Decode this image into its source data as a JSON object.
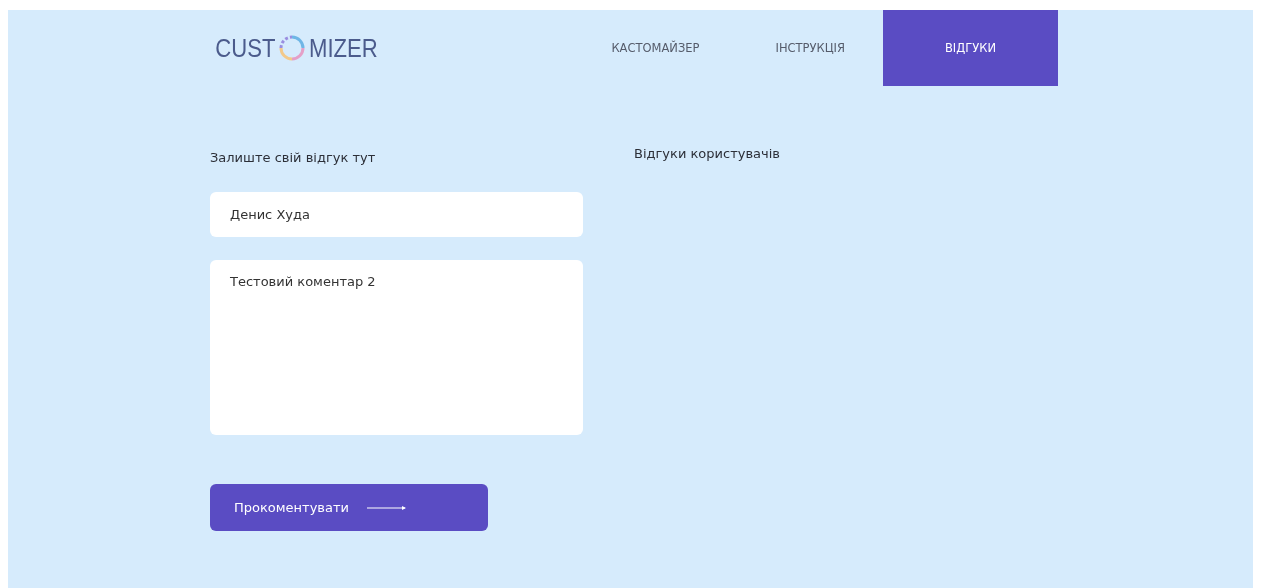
{
  "logo": {
    "before": "CUST",
    "after": "MIZER"
  },
  "nav": [
    {
      "label": "КАСТОМАЙЗЕР",
      "selected": false
    },
    {
      "label": "ІНСТРУКЦІЯ",
      "selected": false
    },
    {
      "label": "ВІДГУКИ",
      "selected": true
    }
  ],
  "form": {
    "title": "Залиште свій відгук тут",
    "name_value": "Денис Худа",
    "comment_value": "Тестовий коментар 2",
    "submit": "Прокоментувати"
  },
  "reviews": {
    "title": "Відгуки користувачів"
  }
}
